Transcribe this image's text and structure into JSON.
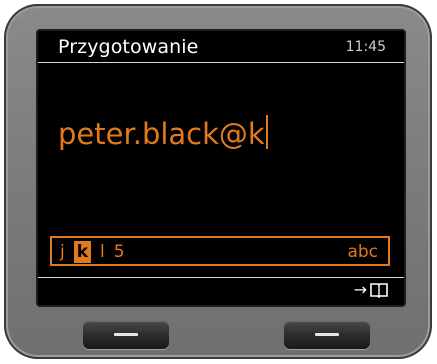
{
  "status_bar": {
    "title": "Przygotowanie",
    "clock": "11:45"
  },
  "input": {
    "value": "peter.black@k"
  },
  "char_bar": {
    "chars": [
      {
        "label": "j",
        "selected": false
      },
      {
        "label": "k",
        "selected": true
      },
      {
        "label": "l",
        "selected": false
      },
      {
        "label": "5",
        "selected": false
      }
    ],
    "mode": "abc"
  },
  "softkeys": {
    "right_arrow": "→",
    "right_icon": "phonebook-icon"
  },
  "colors": {
    "accent": "#e07a1c",
    "screen_bg": "#000000",
    "text": "#ffffff",
    "device": "#7a7a7a"
  }
}
